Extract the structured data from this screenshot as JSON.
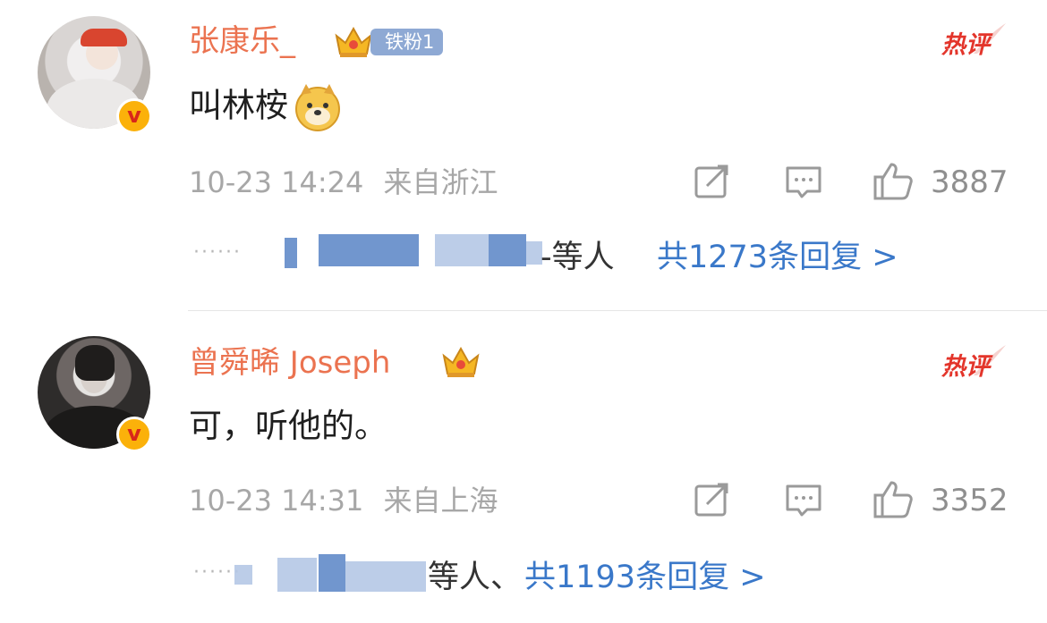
{
  "colors": {
    "username": "#eb7350",
    "link": "#3a78c9",
    "meta": "#a7a7a7",
    "hot": "#e3352b",
    "verified_badge": "#fbb10a",
    "fan_badge": "#8ea9d4"
  },
  "comments": [
    {
      "username": "张康乐_",
      "verified": true,
      "crown_icon": "crown-gold-icon",
      "fan_badge": "铁粉1",
      "hot_label": "热评",
      "content": "叫林桉",
      "emoji": "doge-emoji-icon",
      "timestamp": "10-23 14:24",
      "location": "来自浙江",
      "like_count": "3887",
      "reply_suffix": "-等人",
      "reply_total": "共1273条回复 >"
    },
    {
      "username": "曾舜晞 Joseph",
      "verified": true,
      "crown_icon": "crown-gold-icon",
      "hot_label": "热评",
      "content": "可，听他的。",
      "timestamp": "10-23 14:31",
      "location": "来自上海",
      "like_count": "3352",
      "reply_suffix": "等人、",
      "reply_total": "共1193条回复 >"
    }
  ],
  "reply_dots": "······"
}
